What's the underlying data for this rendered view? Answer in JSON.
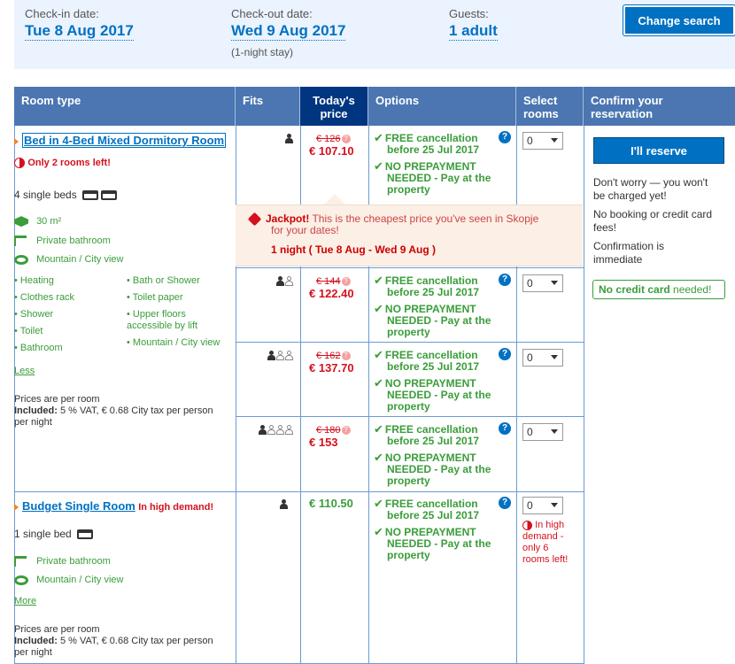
{
  "search": {
    "checkin_label": "Check-in date:",
    "checkin_value": "Tue 8 Aug 2017",
    "checkout_label": "Check-out date:",
    "checkout_value": "Wed 9 Aug 2017",
    "stay_length": "(1-night stay)",
    "guests_label": "Guests:",
    "guests_value": "1 adult",
    "change_button": "Change search"
  },
  "columns": {
    "room_type": "Room type",
    "fits": "Fits",
    "today_price_1": "Today's",
    "today_price_2": "price",
    "options": "Options",
    "select_1": "Select",
    "select_2": "rooms",
    "confirm": "Confirm your reservation"
  },
  "room1": {
    "name": "Bed in 4-Bed Mixed Dormitory Room",
    "scarcity": "Only 2 rooms left!",
    "beds": "4 single beds",
    "size": "30 m²",
    "bathroom": "Private bathroom",
    "view": "Mountain / City view",
    "facilities_left": [
      "Heating",
      "Clothes rack",
      "Shower",
      "Toilet",
      "Bathroom"
    ],
    "facilities_right": [
      "Bath or Shower",
      "Toilet paper",
      "Upper floors accessible by lift",
      "Mountain / City view"
    ],
    "less_link": "Less",
    "prices_note": "Prices are per room",
    "included_label": "Included:",
    "included_text": "5 % VAT, € 0.68 City tax per person per night",
    "rows": [
      {
        "old": "€ 126",
        "new": "€ 107.10",
        "guests": 1
      },
      {
        "old": "€ 144",
        "new": "€ 122.40",
        "guests": 2
      },
      {
        "old": "€ 162",
        "new": "€ 137.70",
        "guests": 3
      },
      {
        "old": "€ 180",
        "new": "€ 153",
        "guests": 4
      }
    ]
  },
  "options": {
    "free_cancel_1": "FREE cancellation",
    "free_cancel_2": "before 25 Jul 2017",
    "noprepay_1": "NO PREPAYMENT",
    "noprepay_2": "NEEDED",
    "noprepay_3": " - Pay at the",
    "noprepay_4": "property"
  },
  "select_default": "0",
  "jackpot": {
    "title": "Jackpot!",
    "text_1": " This is the cheapest price you've seen in Skopje",
    "text_2": "for your dates!",
    "dates": "1 night ( Tue 8 Aug - Wed 9 Aug )"
  },
  "confirm": {
    "reserve_button": "I'll reserve",
    "worry_1": "Don't worry — you won't",
    "worry_2": "be charged yet!",
    "nobooking_1": "No booking or credit card",
    "nobooking_2": "fees!",
    "confirmation_1": "Confirmation is",
    "confirmation_2": "immediate",
    "nocard_bold": "No credit card",
    "nocard_rest": " needed!"
  },
  "room2": {
    "name": "Budget Single Room",
    "demand": "In high demand!",
    "beds": "1 single bed",
    "bathroom": "Private bathroom",
    "view": "Mountain / City view",
    "more_link": "More",
    "price": "€ 110.50",
    "demand_note_1": "In high",
    "demand_note_2": "demand -",
    "demand_note_3": "only 6",
    "demand_note_4": "rooms left!",
    "prices_note": "Prices are per room",
    "included_label": "Included:",
    "included_text": "5 % VAT, € 0.68 City tax per person per night"
  }
}
